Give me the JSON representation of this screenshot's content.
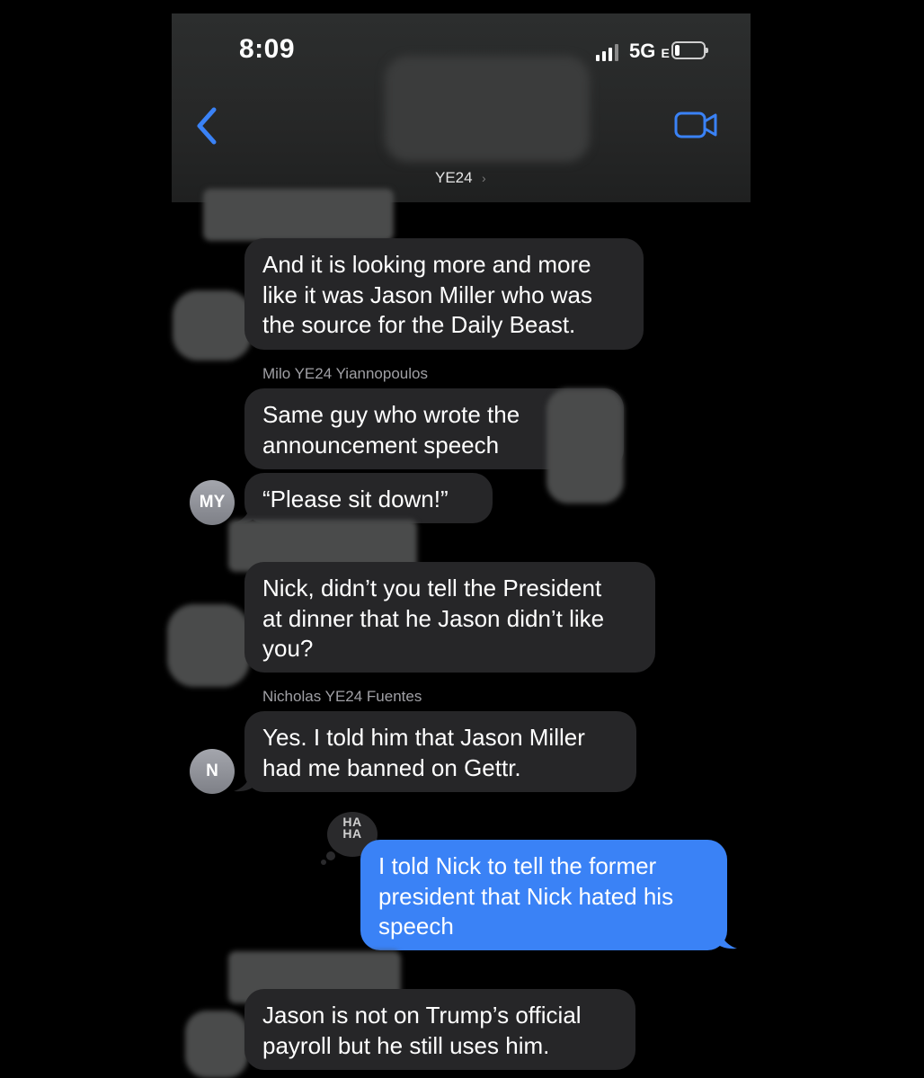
{
  "status_bar": {
    "time": "8:09",
    "network": "5G",
    "network_suffix": "E"
  },
  "header": {
    "back_icon": "chevron-left-icon",
    "video_icon": "video-camera-icon",
    "group_name": "YE24",
    "group_chevron": "›",
    "accent_color": "#3a82f6"
  },
  "messages": [
    {
      "lines": [
        "And it is looking more and more",
        "like it was Jason Miller who was",
        "the source for the Daily Beast."
      ]
    },
    {
      "sender": "Milo YE24 Yiannopoulos",
      "lines": [
        "Same guy who wrote the",
        "announcement speech"
      ]
    },
    {
      "lines": [
        "“Please sit down!”"
      ],
      "avatar": "MY"
    },
    {
      "lines": [
        "Nick, didn’t you tell the President",
        "at dinner that he Jason didn’t like",
        "you?"
      ]
    },
    {
      "sender": "Nicholas YE24 Fuentes",
      "lines": [
        "Yes. I told him that Jason Miller",
        "had me banned on Gettr."
      ],
      "avatar": "N"
    },
    {
      "outgoing": true,
      "tapback": "HA\nHA",
      "lines": [
        "I told Nick to tell the former",
        "president that Nick hated his",
        "speech"
      ]
    },
    {
      "lines": [
        "Jason is not on Trump’s official",
        "payroll but he still uses him."
      ]
    }
  ],
  "colors": {
    "incoming_bubble": "#262628",
    "outgoing_bubble": "#3a82f6",
    "background": "#000000"
  }
}
